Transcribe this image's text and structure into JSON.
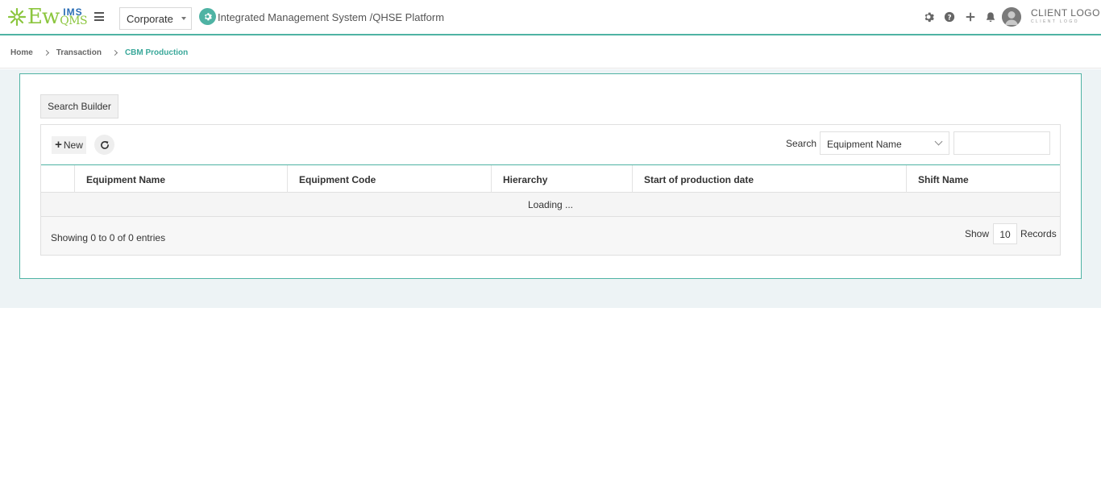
{
  "header": {
    "logo": {
      "ew": "Ew",
      "ims": "IMS",
      "qms": "QMS"
    },
    "company_select": "Corporate",
    "platform_title": "Integrated Management System /QHSE Platform",
    "client_logo": "CLIENT LOGO",
    "client_logo_sub": "CLIENT LOGO",
    "icons": [
      "gear-icon",
      "help-icon",
      "plus-icon",
      "bell-icon",
      "avatar"
    ]
  },
  "breadcrumb": {
    "items": [
      "Home",
      "Transaction"
    ],
    "active": "CBM Production"
  },
  "panel": {
    "search_builder_label": "Search Builder",
    "toolbar": {
      "new_label": "New",
      "search_label": "Search",
      "search_field": "Equipment Name",
      "search_value": ""
    },
    "table": {
      "columns": [
        "",
        "Equipment Name",
        "Equipment Code",
        "Hierarchy",
        "Start of production date",
        "Shift Name"
      ],
      "loading_text": "Loading ..."
    },
    "footer": {
      "info": "Showing 0 to 0 of 0 entries",
      "show_label": "Show",
      "page_size": "10",
      "records_label": "Records"
    }
  },
  "colors": {
    "accent": "#4fb3a4",
    "breadcrumb_active": "#3aa89a",
    "logo_green": "#8cc63f",
    "logo_blue": "#2a6db5"
  }
}
